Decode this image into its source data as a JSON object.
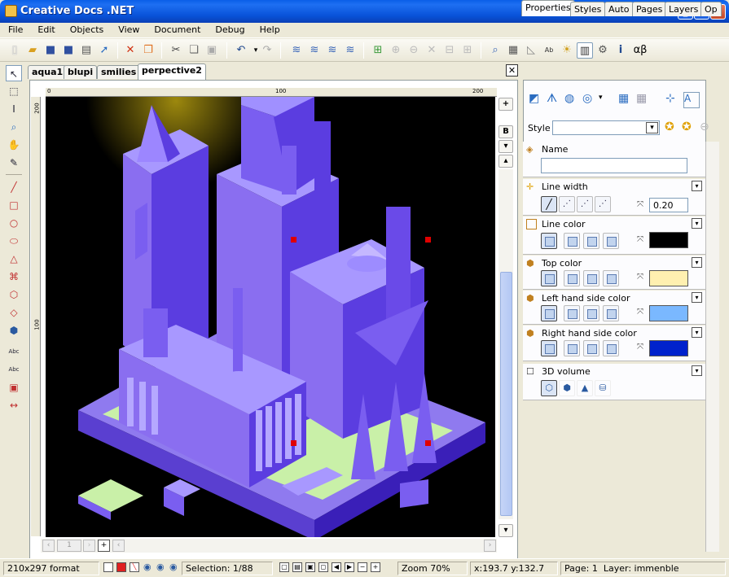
{
  "window": {
    "title": "Creative Docs .NET",
    "minimize": "_",
    "maximize": "□",
    "close": "✕"
  },
  "menu": [
    "File",
    "Edit",
    "Objects",
    "View",
    "Document",
    "Debug",
    "Help"
  ],
  "toolbar": {
    "greek_label": "αβ",
    "icons": [
      "new-icon",
      "open-icon",
      "save-icon",
      "save-as-icon",
      "print-icon",
      "export-icon",
      "delete-icon",
      "duplicate-icon",
      "cut-icon",
      "copy-icon",
      "paste-icon",
      "undo-icon",
      "redo-icon",
      "group-icon",
      "ungroup-icon",
      "merge-icon",
      "extract-icon",
      "add-page-icon",
      "add-layer-icon",
      "remove-icon",
      "close-icon",
      "split-icon",
      "preview-icon",
      "grid-icon",
      "magnet-icon",
      "text-icon",
      "settings-icon",
      "info-icon"
    ]
  },
  "document_tabs": [
    "aqua1",
    "blupi",
    "smilies",
    "perpective2"
  ],
  "active_document_tab": "perpective2",
  "rulers": {
    "h_ticks": [
      "0",
      "100",
      "200"
    ],
    "v_ticks": [
      "200",
      "100"
    ]
  },
  "right_side_buttons": {
    "zoom_in": "+",
    "b_label": "B"
  },
  "panel_tabs": [
    "Properties",
    "Styles",
    "Auto",
    "Pages",
    "Layers",
    "Op"
  ],
  "active_panel_tab": "Properties",
  "style_label": "Style",
  "properties": {
    "name": {
      "label": "Name",
      "value": ""
    },
    "line_width": {
      "label": "Line width",
      "value": "0.20"
    },
    "line_color": {
      "label": "Line color",
      "color": "#000000"
    },
    "top_color": {
      "label": "Top color",
      "color": "#fff0b0"
    },
    "left_color": {
      "label": "Left hand side color",
      "color": "#7ab8ff"
    },
    "right_color": {
      "label": "Right hand side color",
      "color": "#0022cc"
    },
    "volume": {
      "label": "3D volume"
    }
  },
  "status": {
    "format": "210x297 format",
    "selection": "Selection: 1/88",
    "zoom": "Zoom 70%",
    "coords": "x:193.7 y:132.7",
    "page": "Page: 1",
    "layer": "Layer: immenble"
  },
  "hscroll": {
    "page_label": "1",
    "add_label": "+"
  }
}
